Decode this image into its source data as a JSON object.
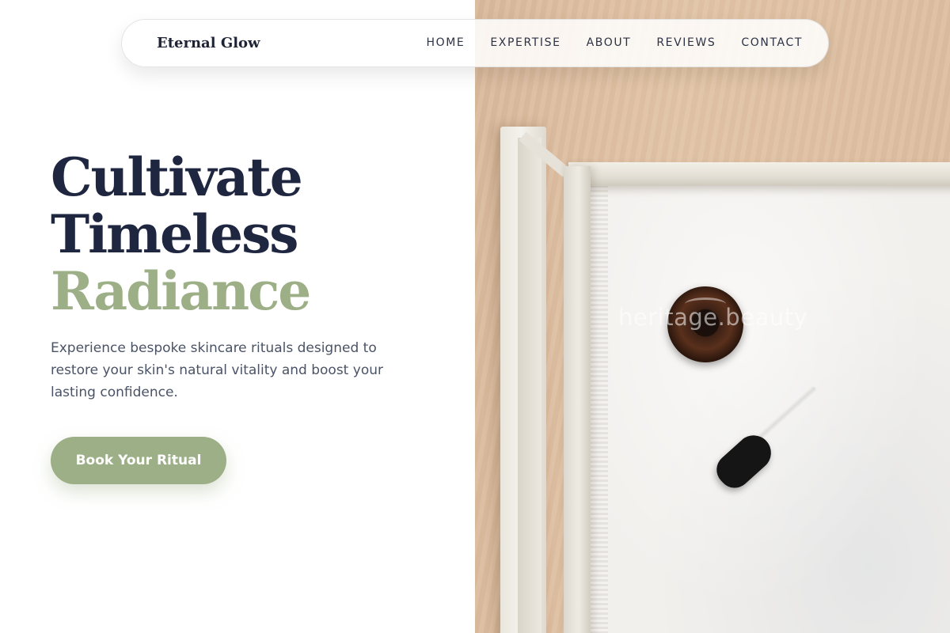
{
  "nav": {
    "brand": "Eternal Glow",
    "links": [
      "HOME",
      "EXPERTISE",
      "ABOUT",
      "REVIEWS",
      "CONTACT"
    ]
  },
  "hero": {
    "title_line_1": "Cultivate",
    "title_line_2": "Timeless",
    "title_line_3": "Radiance",
    "description": "Experience bespoke skincare rituals designed to restore your skin's natural vitality and boost your lasting confidence.",
    "cta_label": "Book Your Ritual"
  },
  "photo": {
    "watermark": "heritage.beauty"
  },
  "colors": {
    "navy": "#1e2640",
    "sage": "#9daf86",
    "body_text": "#4a5366",
    "background": "#ffffff"
  }
}
